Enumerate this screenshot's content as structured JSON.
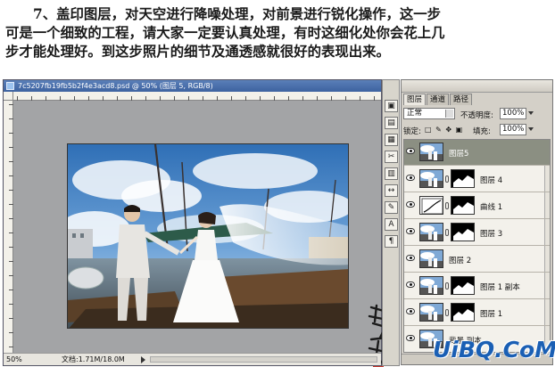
{
  "instruction": {
    "line1": "7、盖印图层，对天空进行降噪处理，对前景进行锐化操作，这一步",
    "line2": "可是一个细致的工程，请大家一定要认真处理，有时这细化处你会花上几",
    "line3": "步才能处理好。到这步照片的细节及通透感就很好的表现出来。"
  },
  "document": {
    "title": "7c5207fb19fb5b2f4e3acd8.psd @ 50% (图层 5, RGB/8)",
    "zoom": "50%",
    "doc_size": "文档:1.71M/18.0M"
  },
  "layers_panel": {
    "tabs": [
      "图层",
      "通道",
      "路径"
    ],
    "blend_mode": "正常",
    "opacity_label": "不透明度:",
    "opacity_value": "100%",
    "lock_label": "锁定:",
    "fill_label": "填充:",
    "fill_value": "100%",
    "layers": [
      {
        "name": "图层5",
        "has_mask": false,
        "active": true
      },
      {
        "name": "图层 4",
        "has_mask": true,
        "active": false
      },
      {
        "name": "曲线 1",
        "has_mask": true,
        "active": false,
        "adjustment": true
      },
      {
        "name": "图层 3",
        "has_mask": true,
        "active": false
      },
      {
        "name": "图层 2",
        "has_mask": false,
        "active": false
      },
      {
        "name": "图层 1 副本",
        "has_mask": true,
        "active": false
      },
      {
        "name": "图层 1",
        "has_mask": true,
        "active": false
      },
      {
        "name": "背景 副本",
        "has_mask": false,
        "active": false
      }
    ]
  },
  "tools": [
    "移动",
    "画笔",
    "编辑",
    "剪切",
    "路径",
    "选择",
    "吸管",
    "文字",
    "段落"
  ],
  "watermark": "UiBQ.CoM"
}
